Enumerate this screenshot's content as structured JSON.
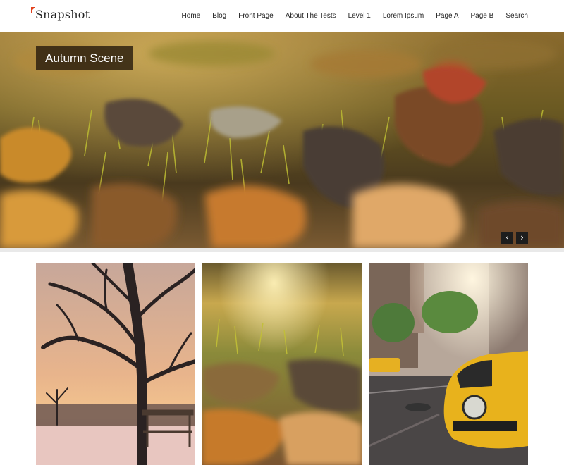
{
  "site": {
    "title": "Snapshot"
  },
  "nav": {
    "items": [
      {
        "label": "Home"
      },
      {
        "label": "Blog"
      },
      {
        "label": "Front Page"
      },
      {
        "label": "About The Tests"
      },
      {
        "label": "Level 1"
      },
      {
        "label": "Lorem Ipsum"
      },
      {
        "label": "Page A"
      },
      {
        "label": "Page B"
      },
      {
        "label": "Search"
      }
    ]
  },
  "slider": {
    "caption": "Autumn Scene",
    "prev_icon": "chevron-left-icon",
    "next_icon": "chevron-right-icon",
    "prev_glyph": "‹",
    "next_glyph": "›"
  },
  "gallery": {
    "photos": [
      {
        "subject": "bare-tree-photo"
      },
      {
        "subject": "autumn-leaves-photo"
      },
      {
        "subject": "city-taxi-photo"
      }
    ]
  },
  "colors": {
    "accent": "#e2401c",
    "caption_bg": "#281c0e",
    "nav_text": "#222222"
  }
}
